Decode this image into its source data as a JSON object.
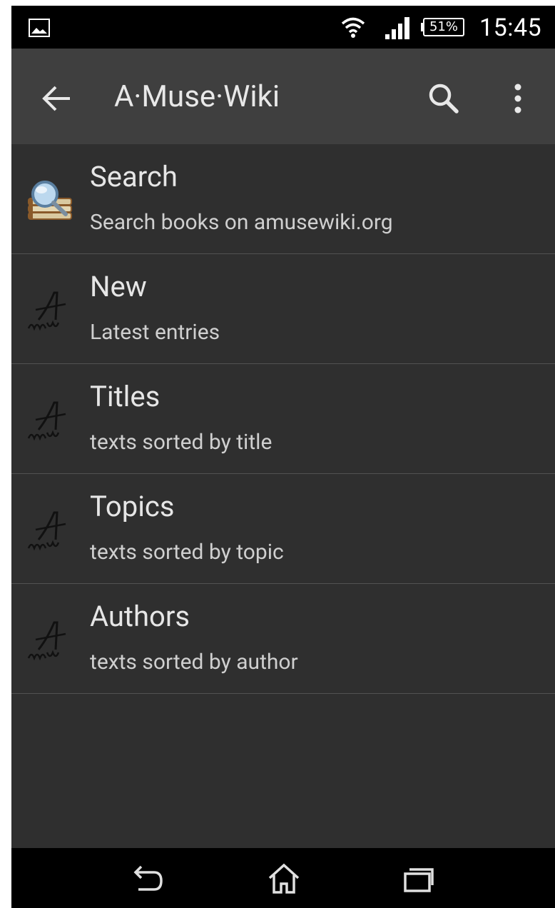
{
  "status_bar": {
    "battery_percent": "51%",
    "time": "15:45",
    "icons": [
      "image-notification-icon",
      "wifi-icon",
      "signal-icon",
      "battery-icon"
    ]
  },
  "action_bar": {
    "title": "A·Muse·Wiki",
    "icons": [
      "back-arrow-icon",
      "search-icon",
      "overflow-menu-icon"
    ]
  },
  "menu": {
    "items": [
      {
        "title": "Search",
        "subtitle": "Search books on amusewiki.org",
        "icon": "search-books-icon"
      },
      {
        "title": "New",
        "subtitle": "Latest entries",
        "icon": "amusewiki-logo-icon"
      },
      {
        "title": "Titles",
        "subtitle": "texts sorted by title",
        "icon": "amusewiki-logo-icon"
      },
      {
        "title": "Topics",
        "subtitle": "texts sorted by topic",
        "icon": "amusewiki-logo-icon"
      },
      {
        "title": "Authors",
        "subtitle": "texts sorted by author",
        "icon": "amusewiki-logo-icon"
      }
    ]
  },
  "nav_bar": {
    "icons": [
      "nav-back-icon",
      "nav-home-icon",
      "nav-recent-apps-icon"
    ]
  },
  "colors": {
    "background": "#2f2f2f",
    "action_bar": "#3f3f3f",
    "status_bar": "#000000",
    "divider": "#525252",
    "text_primary": "#e6e6e6",
    "text_secondary": "#cfcfcf"
  }
}
